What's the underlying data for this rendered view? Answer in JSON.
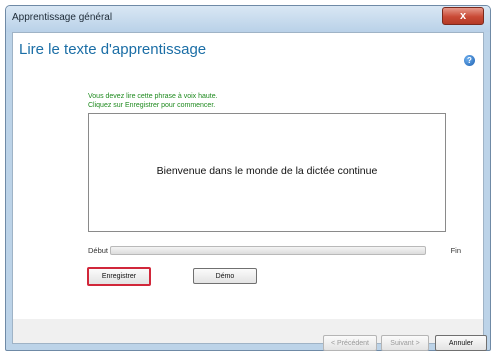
{
  "window": {
    "title": "Apprentissage général",
    "close_label": "x"
  },
  "page": {
    "title": "Lire le texte d'apprentissage",
    "help_label": "?"
  },
  "instructions": {
    "line1": "Vous devez lire cette phrase à voix haute.",
    "line2": "Cliquez sur Enregistrer pour commencer."
  },
  "phrase": "Bienvenue dans le monde de la dictée continue",
  "progress": {
    "start_label": "Début",
    "end_label": "Fin",
    "value": 0
  },
  "buttons": {
    "record": "Enregistrer",
    "demo": "Démo",
    "previous": "< Précédent",
    "next": "Suivant >",
    "cancel": "Annuler"
  },
  "colors": {
    "title_blue": "#1b6ea6",
    "instruction_green": "#1e8a1e",
    "highlight_red": "#d1273a"
  }
}
